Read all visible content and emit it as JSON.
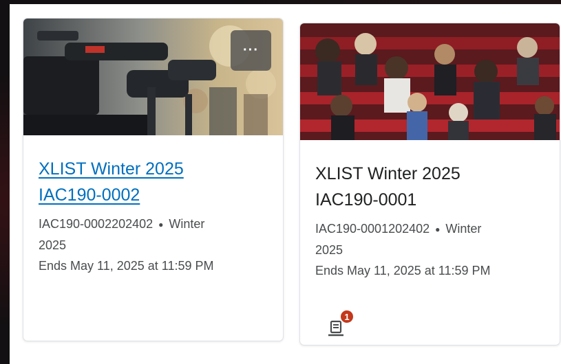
{
  "courses": [
    {
      "title_line1": "XLIST Winter 2025",
      "title_line2": "IAC190-0002",
      "code": "IAC190-0002202402",
      "semester_part1": "Winter",
      "semester_part2": "2025",
      "end_date": "Ends May 11, 2025 at 11:59 PM",
      "image_icon": "camera-crew-image",
      "menu_label": "···"
    },
    {
      "title_line1": "XLIST Winter 2025",
      "title_line2": "IAC190-0001",
      "code": "IAC190-0001202402",
      "semester_part1": "Winter",
      "semester_part2": "2025",
      "end_date": "Ends May 11, 2025 at 11:59 PM",
      "image_icon": "audience-image",
      "notification_count": "1",
      "notification_icon": "assignment-icon"
    }
  ],
  "colors": {
    "link": "#006fbf",
    "badge": "#c4381b",
    "text": "#202122",
    "secondary_text": "#494c4e"
  }
}
